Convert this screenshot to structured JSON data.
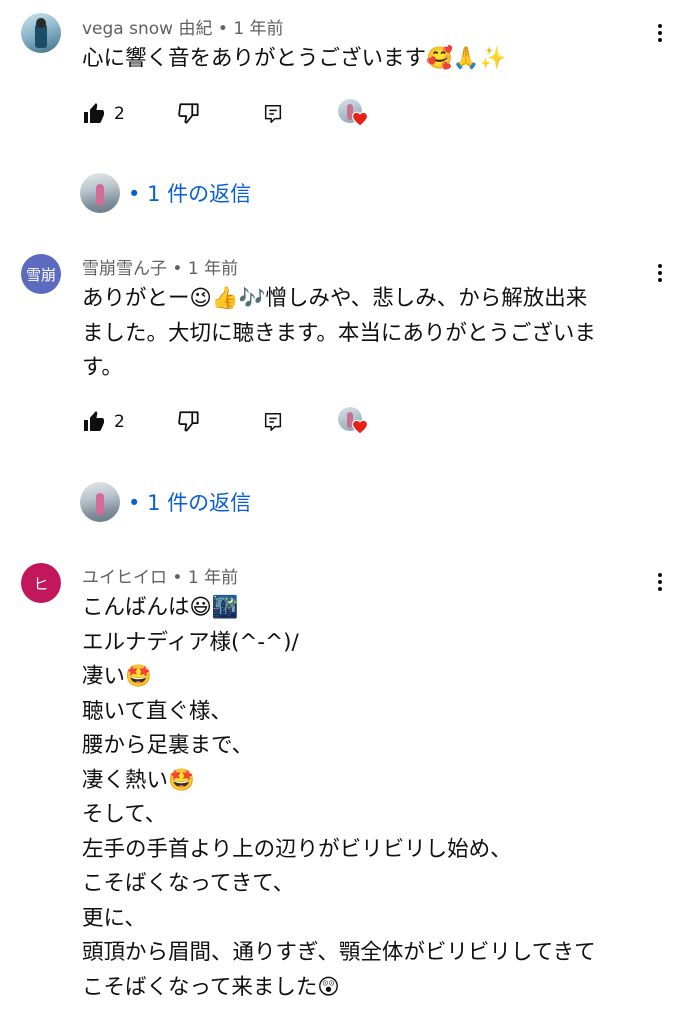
{
  "comments": [
    {
      "avatar_text": "",
      "avatar_color": "#8fb8cc",
      "author": "vega snow 由紀",
      "time": "1 年前",
      "body": "心に響く音をありがとうございます🥰🙏✨",
      "likes": "2",
      "replies": "1 件の返信"
    },
    {
      "avatar_text": "雪崩",
      "avatar_color": "#5c6bc0",
      "author": "雪崩雪ん子",
      "time": "1 年前",
      "body": "ありがとー😉👍🎶憎しみや、悲しみ、から解放出来\nました。大切に聴きます。本当にありがとうございま\nす。",
      "likes": "2",
      "replies": "1 件の返信"
    },
    {
      "avatar_text": "ヒ",
      "avatar_color": "#c2185b",
      "author": "ユイヒイロ",
      "time": "1 年前",
      "body": "こんばんは😃🌃\nエルナディア様(^-^)/\n凄い🤩\n聴いて直ぐ様、\n腰から足裏まで、\n凄く熱い🤩\nそして、\n左手の手首より上の辺りがビリビリし始め、\nこそばくなってきて、\n更に、\n頭頂から眉間、通りすぎ、顎全体がビリビリしてきて\nこそばくなって来ました😲"
    }
  ],
  "icons": {
    "like": "thumbs-up-icon",
    "dislike": "thumbs-down-icon",
    "reply": "reply-comment-icon",
    "menu": "more-vert-icon",
    "creator_heart": "creator-heart-icon"
  },
  "colors": {
    "link": "#065fd4",
    "meta": "#606060",
    "heart": "#e62117"
  }
}
